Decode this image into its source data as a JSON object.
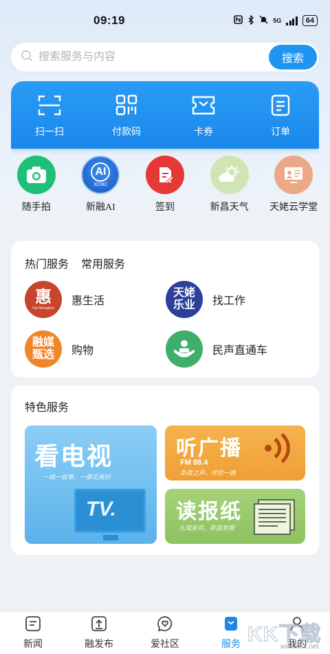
{
  "status": {
    "time": "09:19",
    "network": "5G",
    "battery": "64"
  },
  "search": {
    "placeholder": "搜索服务与内容",
    "button_label": "搜索"
  },
  "quick_actions": [
    {
      "label": "扫一扫",
      "icon": "scan-icon"
    },
    {
      "label": "付款码",
      "icon": "qr-code-icon"
    },
    {
      "label": "卡券",
      "icon": "coupon-icon"
    },
    {
      "label": "订单",
      "icon": "order-icon"
    }
  ],
  "apps": [
    {
      "label": "随手拍",
      "icon": "camera-icon",
      "color": "#1fbf7a"
    },
    {
      "label": "新融AI",
      "icon": "ai-icon",
      "color": "#1e6fd9",
      "badge": "AI",
      "badge_sub": "XCMC"
    },
    {
      "label": "签到",
      "icon": "sign-in-icon",
      "color": "#e53935"
    },
    {
      "label": "新昌天气",
      "icon": "weather-icon",
      "color": "#c5e3a9"
    },
    {
      "label": "天姥云学堂",
      "icon": "classroom-icon",
      "color": "#e9a27e"
    }
  ],
  "hot_services": {
    "tabs": [
      "热门服务",
      "常用服务"
    ],
    "items": [
      {
        "label": "惠生活",
        "logo_text": "惠",
        "logo_sub": "Hui Shenghuo",
        "color": "#c6452c"
      },
      {
        "label": "找工作",
        "logo_text": "天姥乐业",
        "color": "#2c3f9b"
      },
      {
        "label": "购物",
        "logo_text": "融媒甄选",
        "color": "#f0852a"
      },
      {
        "label": "民声直通车",
        "logo_text": "",
        "color": "#3fae6a"
      }
    ]
  },
  "featured": {
    "title": "特色服务",
    "tv": {
      "title": "看电视",
      "subtitle": "一城一故事，一屏见美好",
      "screen_text": "TV."
    },
    "radio": {
      "title": "听广播",
      "subtitle": "FM 88.4",
      "tagline": "新昌之声，伴您一路"
    },
    "paper": {
      "title": "读报纸",
      "tagline": "九域来风，新昌有报"
    }
  },
  "bottom_nav": [
    {
      "label": "新闻",
      "icon": "news-icon",
      "active": false
    },
    {
      "label": "融发布",
      "icon": "publish-icon",
      "active": false
    },
    {
      "label": "爱社区",
      "icon": "community-icon",
      "active": false
    },
    {
      "label": "服务",
      "icon": "service-icon",
      "active": true
    },
    {
      "label": "我的",
      "icon": "profile-icon",
      "active": false
    }
  ],
  "watermark": {
    "text": "KK下载",
    "url_text": "www.kkx.net"
  },
  "colors": {
    "accent": "#1e95f0",
    "active_nav": "#1e88e5"
  }
}
